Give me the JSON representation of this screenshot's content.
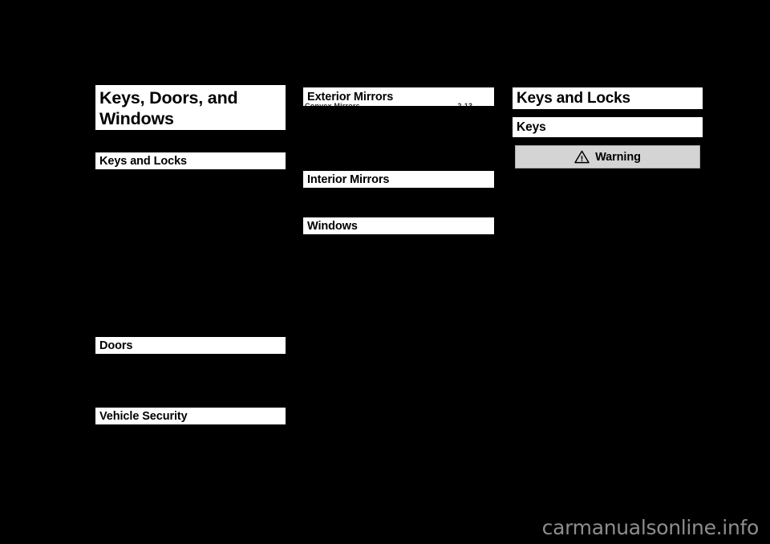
{
  "document": {
    "chapter_title_line1": "Keys, Doors, and",
    "chapter_title_line2": "Windows"
  },
  "left_column": {
    "sections": [
      {
        "label": "Keys and Locks"
      },
      {
        "label": "Doors"
      },
      {
        "label": "Vehicle Security"
      }
    ]
  },
  "middle_column": {
    "sections": [
      {
        "label": "Exterior Mirrors"
      },
      {
        "label": "Interior Mirrors"
      },
      {
        "label": "Windows"
      }
    ],
    "ghost_text": "Convex Mirrors . . . . . . . . . . . . . . . . . . . . . . 2-13"
  },
  "right_column": {
    "chapter_heading": "Keys and Locks",
    "sub_heading": "Keys",
    "warning": {
      "icon": "warning-triangle-icon",
      "label": "Warning"
    }
  },
  "watermark": {
    "text": "carmanualsonline.info",
    "color": "#8d8d8d"
  },
  "colors": {
    "page_background": "#000000",
    "highlight_band": "#ffffff",
    "text": "#000000",
    "warning_background": "#d4d4d4",
    "warning_border": "#a8a8a8"
  }
}
